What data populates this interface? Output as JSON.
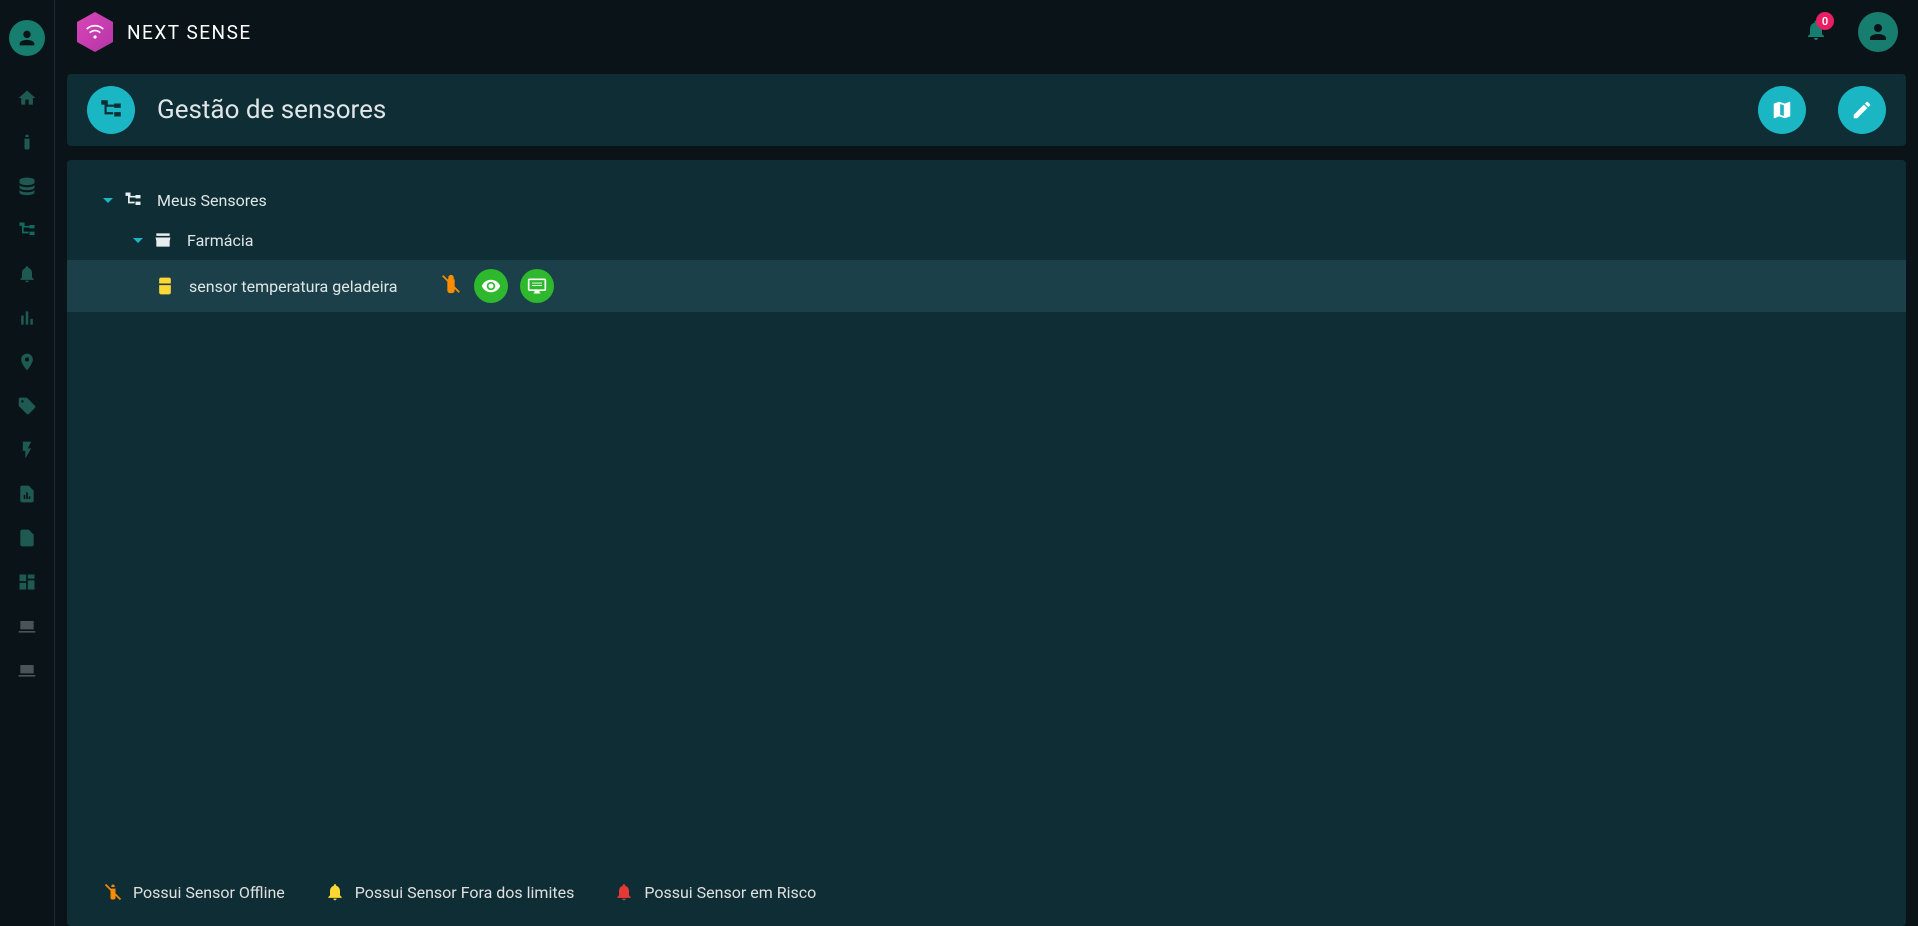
{
  "brand": "NEXT SENSE",
  "notifications": {
    "count": "0"
  },
  "page": {
    "title": "Gestão de sensores"
  },
  "tree": {
    "root": {
      "label": "Meus Sensores"
    },
    "group": {
      "label": "Farmácia"
    },
    "sensor": {
      "label": "sensor temperatura geladeira"
    }
  },
  "legend": {
    "offline": "Possui Sensor Offline",
    "out_of_limits": "Possui Sensor Fora dos limites",
    "at_risk": "Possui Sensor em Risco"
  }
}
